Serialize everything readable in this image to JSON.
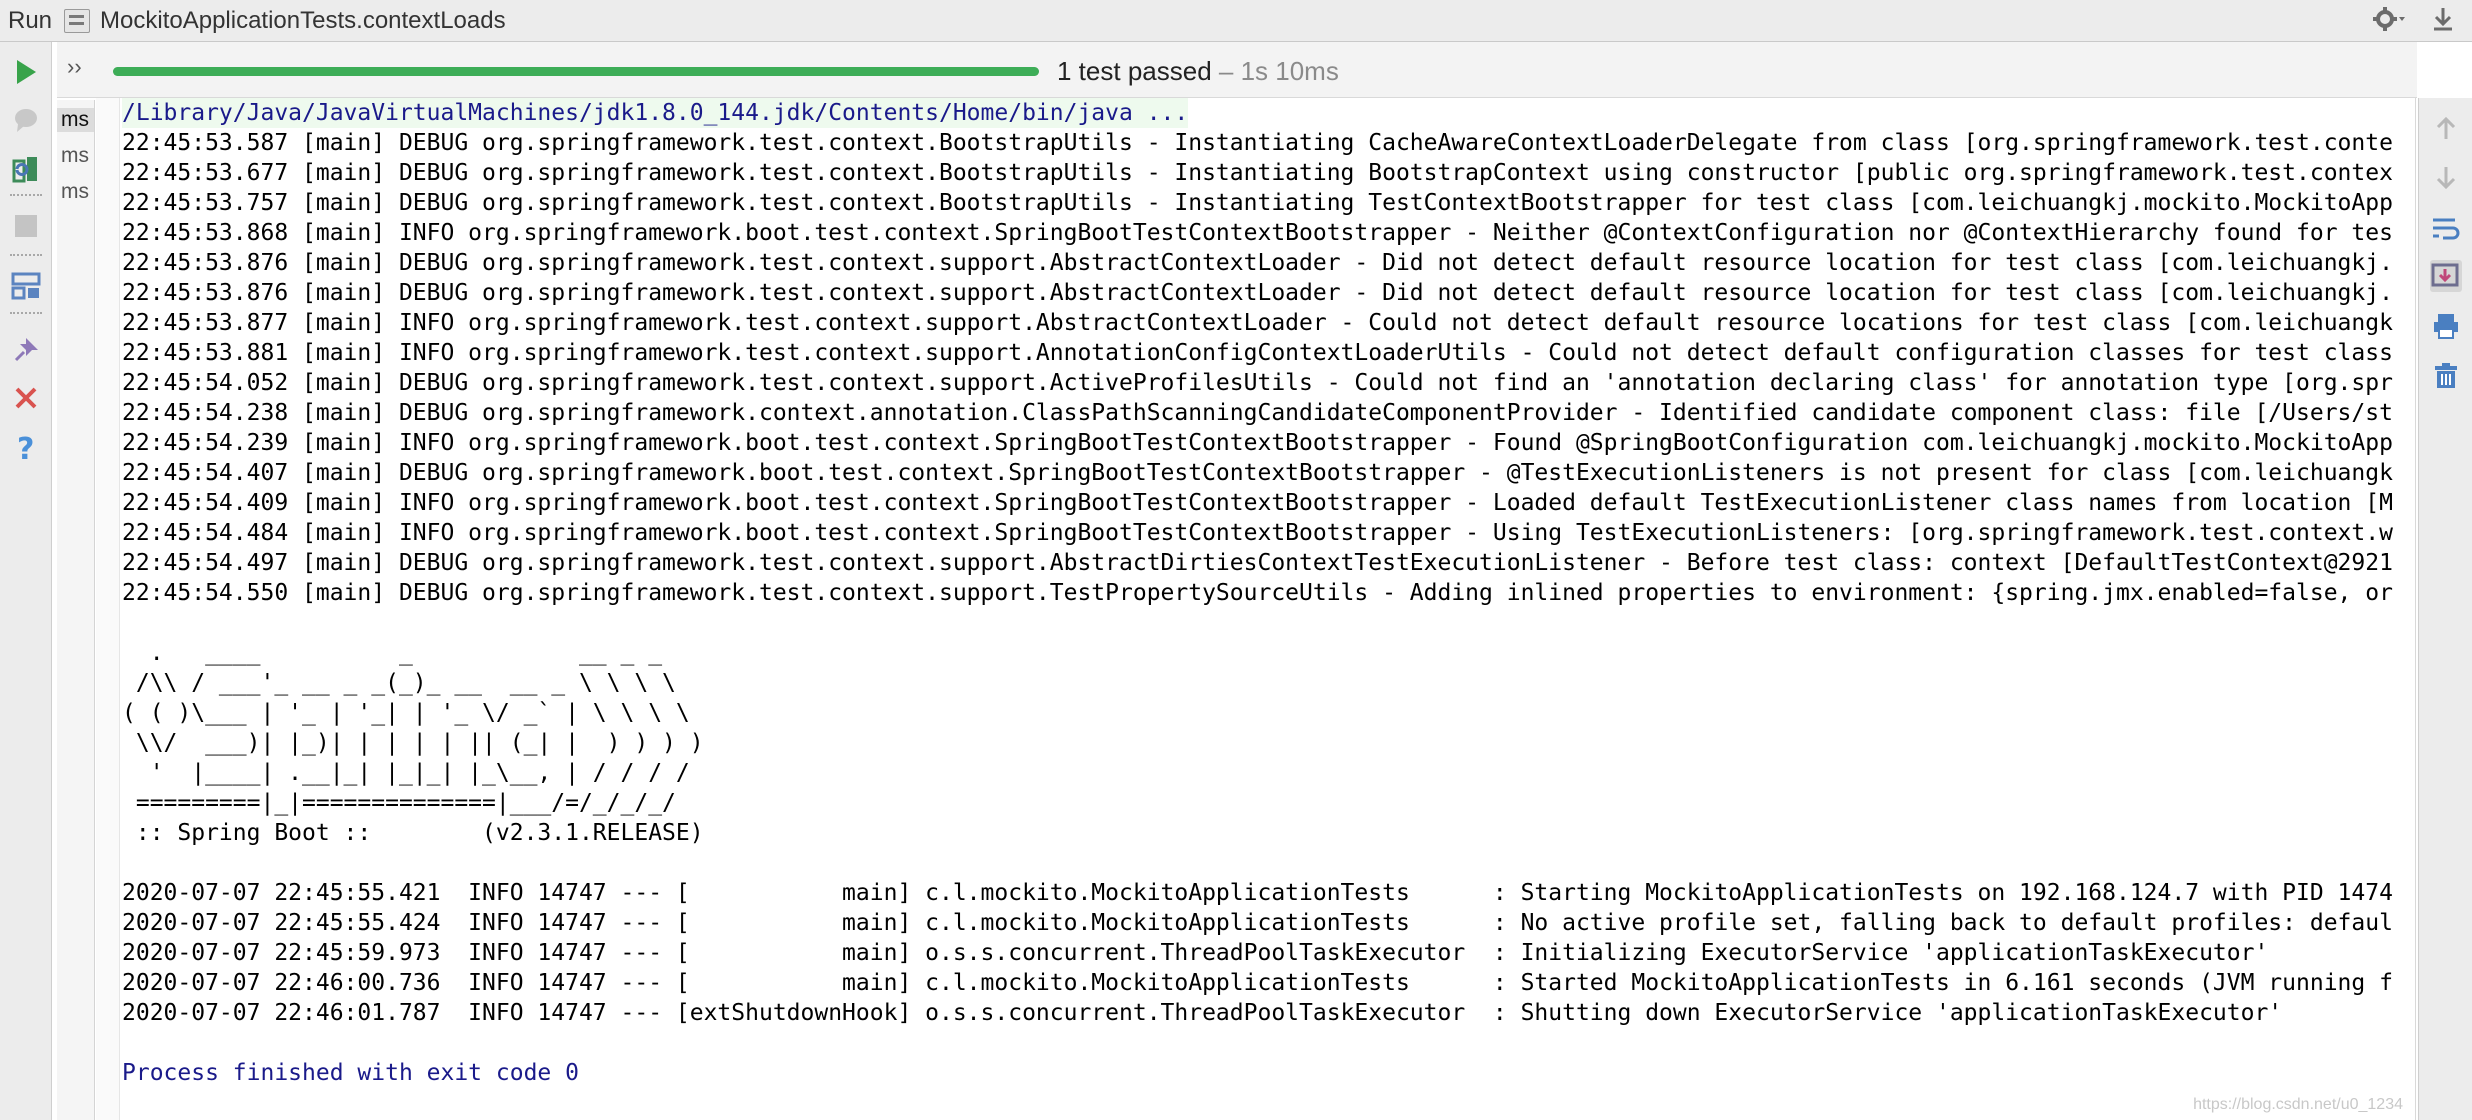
{
  "titlebar": {
    "run_label": "Run",
    "config_name": "MockitoApplicationTests.contextLoads",
    "icons": [
      "gear-icon",
      "download-icon"
    ]
  },
  "status": {
    "expand_icon": "››",
    "progress_fraction": 1.0,
    "progress_color": "#3dad57",
    "passed_text": "1 test passed",
    "time_text": " – 1s 10ms"
  },
  "tree": {
    "items": [
      "ms",
      "ms",
      "ms"
    ]
  },
  "console": {
    "command_line": "/Library/Java/JavaVirtualMachines/jdk1.8.0_144.jdk/Contents/Home/bin/java ...",
    "log_lines": [
      "22:45:53.587 [main] DEBUG org.springframework.test.context.BootstrapUtils - Instantiating CacheAwareContextLoaderDelegate from class [org.springframework.test.conte",
      "22:45:53.677 [main] DEBUG org.springframework.test.context.BootstrapUtils - Instantiating BootstrapContext using constructor [public org.springframework.test.contex",
      "22:45:53.757 [main] DEBUG org.springframework.test.context.BootstrapUtils - Instantiating TestContextBootstrapper for test class [com.leichuangkj.mockito.MockitoApp",
      "22:45:53.868 [main] INFO org.springframework.boot.test.context.SpringBootTestContextBootstrapper - Neither @ContextConfiguration nor @ContextHierarchy found for tes",
      "22:45:53.876 [main] DEBUG org.springframework.test.context.support.AbstractContextLoader - Did not detect default resource location for test class [com.leichuangkj.",
      "22:45:53.876 [main] DEBUG org.springframework.test.context.support.AbstractContextLoader - Did not detect default resource location for test class [com.leichuangkj.",
      "22:45:53.877 [main] INFO org.springframework.test.context.support.AbstractContextLoader - Could not detect default resource locations for test class [com.leichuangk",
      "22:45:53.881 [main] INFO org.springframework.test.context.support.AnnotationConfigContextLoaderUtils - Could not detect default configuration classes for test class",
      "22:45:54.052 [main] DEBUG org.springframework.test.context.support.ActiveProfilesUtils - Could not find an 'annotation declaring class' for annotation type [org.spr",
      "22:45:54.238 [main] DEBUG org.springframework.context.annotation.ClassPathScanningCandidateComponentProvider - Identified candidate component class: file [/Users/st",
      "22:45:54.239 [main] INFO org.springframework.boot.test.context.SpringBootTestContextBootstrapper - Found @SpringBootConfiguration com.leichuangkj.mockito.MockitoApp",
      "22:45:54.407 [main] DEBUG org.springframework.boot.test.context.SpringBootTestContextBootstrapper - @TestExecutionListeners is not present for class [com.leichuangk",
      "22:45:54.409 [main] INFO org.springframework.boot.test.context.SpringBootTestContextBootstrapper - Loaded default TestExecutionListener class names from location [M",
      "22:45:54.484 [main] INFO org.springframework.boot.test.context.SpringBootTestContextBootstrapper - Using TestExecutionListeners: [org.springframework.test.context.w",
      "22:45:54.497 [main] DEBUG org.springframework.test.context.support.AbstractDirtiesContextTestExecutionListener - Before test class: context [DefaultTestContext@2921",
      "22:45:54.550 [main] DEBUG org.springframework.test.context.support.TestPropertySourceUtils - Adding inlined properties to environment: {spring.jmx.enabled=false, or"
    ],
    "banner_lines": [
      "  .   ____          _            __ _ _",
      " /\\\\ / ___'_ __ _ _(_)_ __  __ _ \\ \\ \\ \\",
      "( ( )\\___ | '_ | '_| | '_ \\/ _` | \\ \\ \\ \\",
      " \\\\/  ___)| |_)| | | | | || (_| |  ) ) ) )",
      "  '  |____| .__|_| |_|_| |_\\__, | / / / /",
      " =========|_|==============|___/=/_/_/_/",
      " :: Spring Boot ::        (v2.3.1.RELEASE)"
    ],
    "app_lines": [
      "2020-07-07 22:45:55.421  INFO 14747 --- [           main] c.l.mockito.MockitoApplicationTests      : Starting MockitoApplicationTests on 192.168.124.7 with PID 1474",
      "2020-07-07 22:45:55.424  INFO 14747 --- [           main] c.l.mockito.MockitoApplicationTests      : No active profile set, falling back to default profiles: defaul",
      "2020-07-07 22:45:59.973  INFO 14747 --- [           main] o.s.s.concurrent.ThreadPoolTaskExecutor  : Initializing ExecutorService 'applicationTaskExecutor'",
      "2020-07-07 22:46:00.736  INFO 14747 --- [           main] c.l.mockito.MockitoApplicationTests      : Started MockitoApplicationTests in 6.161 seconds (JVM running f",
      "2020-07-07 22:46:01.787  INFO 14747 --- [extShutdownHook] o.s.s.concurrent.ThreadPoolTaskExecutor  : Shutting down ExecutorService 'applicationTaskExecutor'"
    ],
    "exit_line": "Process finished with exit code 0"
  },
  "left_toolbar": {
    "icons": [
      "run-icon",
      "rerun-failed-icon",
      "toggle-auto-test-icon",
      "stop-icon",
      "layout-icon",
      "pin-icon",
      "close-icon",
      "help-icon"
    ]
  },
  "right_toolbar": {
    "icons": [
      "scroll-up-icon",
      "scroll-down-icon",
      "soft-wrap-icon",
      "scroll-to-end-icon",
      "print-icon",
      "clear-icon"
    ]
  },
  "watermark": "https://blog.csdn.net/u0_1234"
}
